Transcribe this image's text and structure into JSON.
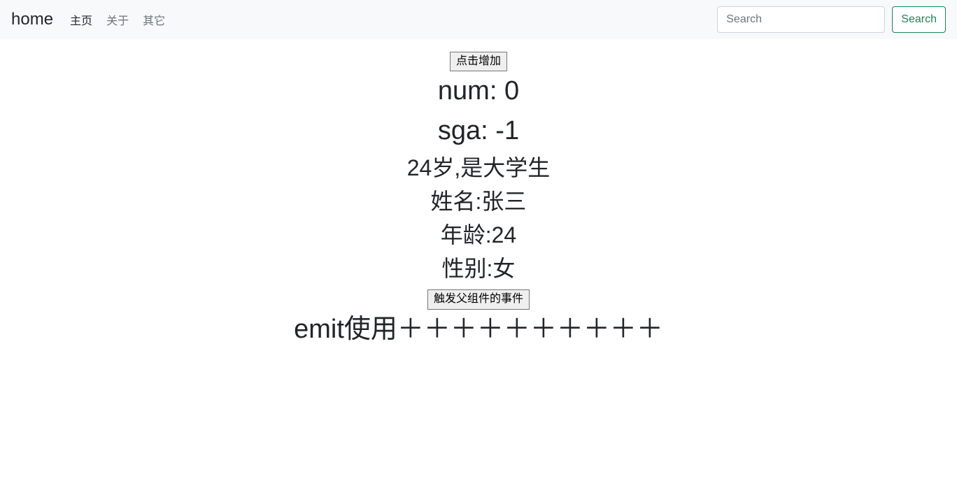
{
  "navbar": {
    "brand": "home",
    "links": [
      {
        "label": "主页",
        "active": true
      },
      {
        "label": "关于",
        "active": false
      },
      {
        "label": "其它",
        "active": false
      }
    ],
    "search_placeholder": "Search",
    "search_button": "Search"
  },
  "main": {
    "increment_button": "点击增加",
    "num_line": "num: 0",
    "sga_line": "sga: -1",
    "age_student_line": "24岁,是大学生",
    "name_line": "姓名:张三",
    "age_line": "年龄:24",
    "gender_line": "性别:女",
    "trigger_button": "触发父组件的事件",
    "emit_line": "emit使用＋＋＋＋＋＋＋＋＋＋"
  }
}
